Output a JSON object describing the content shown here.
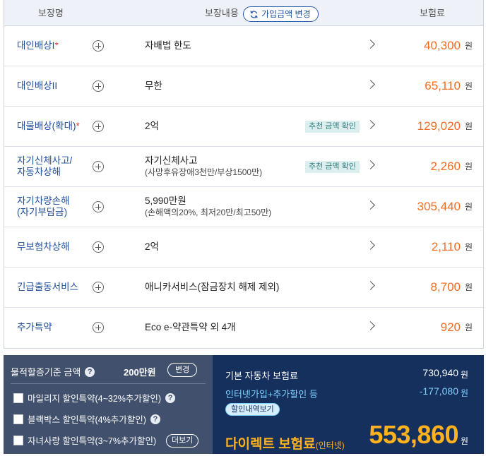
{
  "table": {
    "headers": {
      "name": "보장명",
      "content": "보장내용",
      "premium": "보험료"
    },
    "change_amount_label": "가입금액 변경",
    "won": "원",
    "rows": [
      {
        "name1": "대인배상I",
        "star": "*",
        "name2": "",
        "content": "자배법 한도",
        "sub": "",
        "recommend": "",
        "price": "40,300"
      },
      {
        "name1": "대인배상II",
        "star": "",
        "name2": "",
        "content": "무한",
        "sub": "",
        "recommend": "",
        "price": "65,110"
      },
      {
        "name1": "대물배상(확대)",
        "star": "*",
        "name2": "",
        "content": "2억",
        "sub": "",
        "recommend": "추천 금액 확인",
        "price": "129,020"
      },
      {
        "name1": "자기신체사고/",
        "star": "",
        "name2": "자동차상해",
        "content": "자기신체사고",
        "sub": "(사망후유장애3천만/부상1500만)",
        "recommend": "추천 금액 확인",
        "price": "2,260"
      },
      {
        "name1": "자기차량손해",
        "star": "",
        "name2": "(자기부담금)",
        "content": "5,990만원",
        "sub": "(손해액의20%, 최저20만/최고50만)",
        "recommend": "",
        "price": "305,440"
      },
      {
        "name1": "무보험차상해",
        "star": "",
        "name2": "",
        "content": "2억",
        "sub": "",
        "recommend": "",
        "price": "2,110"
      },
      {
        "name1": "긴급출동서비스",
        "star": "",
        "name2": "",
        "content": "애니카서비스(잠금장치 해제 제외)",
        "sub": "",
        "recommend": "",
        "price": "8,700"
      },
      {
        "name1": "추가특약",
        "star": "",
        "name2": "",
        "content": "Eco e-약관특약 외 4개",
        "sub": "",
        "recommend": "",
        "price": "920"
      }
    ]
  },
  "left_panel": {
    "amount_label": "물적할증기준 금액",
    "amount_value": "200만원",
    "change_label": "변경",
    "options": [
      "마일리지 할인특약(4~32%추가할인)",
      "블랙박스 할인특약(4%추가할인)",
      "자녀사랑 할인특약(3~7%추가할인)"
    ],
    "more_label": "더보기",
    "help_glyph": "?"
  },
  "right_panel": {
    "base_label": "기본 자동차 보험료",
    "base_value": "730,940",
    "discount_label": "인터넷가입+추가할인 등",
    "discount_value": "-177,080",
    "detail_label": "할인내역보기",
    "final_label": "다이렉트 보험료",
    "final_sub": "(인터넷)",
    "final_value": "553,860",
    "won": "원"
  },
  "colors": {
    "accent_blue": "#1f4e9c",
    "price_orange": "#f26d21",
    "final_yellow": "#ffb21e",
    "discount_cyan": "#7fd1ff"
  },
  "icons": {
    "refresh": "refresh-icon",
    "plus": "plus-circle-icon",
    "chevron": "chevron-right-icon",
    "help": "help-icon"
  }
}
